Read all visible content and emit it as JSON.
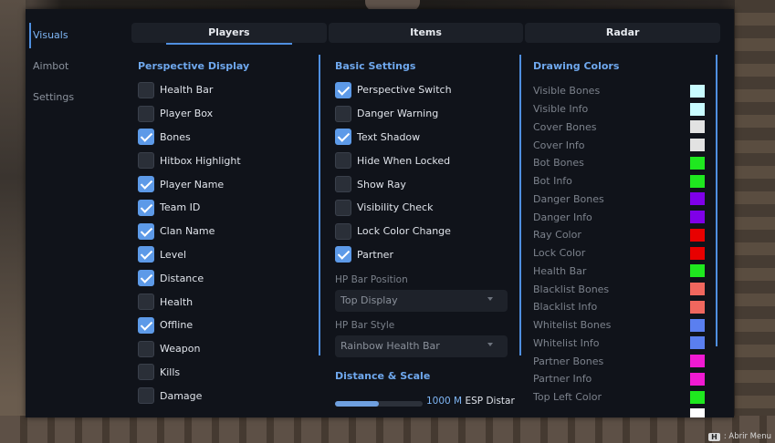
{
  "nav": {
    "items": [
      {
        "label": "Visuals",
        "active": true
      },
      {
        "label": "Aimbot",
        "active": false
      },
      {
        "label": "Settings",
        "active": false
      }
    ]
  },
  "tabs": [
    {
      "label": "Players",
      "active": true
    },
    {
      "label": "Items",
      "active": false
    },
    {
      "label": "Radar",
      "active": false
    }
  ],
  "perspective": {
    "title": "Perspective Display",
    "options": [
      {
        "label": "Health Bar",
        "checked": false
      },
      {
        "label": "Player Box",
        "checked": false
      },
      {
        "label": "Bones",
        "checked": true
      },
      {
        "label": "Hitbox Highlight",
        "checked": false
      },
      {
        "label": "Player Name",
        "checked": true
      },
      {
        "label": "Team ID",
        "checked": true
      },
      {
        "label": "Clan Name",
        "checked": true
      },
      {
        "label": "Level",
        "checked": true
      },
      {
        "label": "Distance",
        "checked": true
      },
      {
        "label": "Health",
        "checked": false
      },
      {
        "label": "Offline",
        "checked": true
      },
      {
        "label": "Weapon",
        "checked": false
      },
      {
        "label": "Kills",
        "checked": false
      },
      {
        "label": "Damage",
        "checked": false
      }
    ]
  },
  "basic": {
    "title": "Basic Settings",
    "options": [
      {
        "label": "Perspective Switch",
        "checked": true
      },
      {
        "label": "Danger Warning",
        "checked": false
      },
      {
        "label": "Text Shadow",
        "checked": true
      },
      {
        "label": "Hide When Locked",
        "checked": false
      },
      {
        "label": "Show Ray",
        "checked": false
      },
      {
        "label": "Visibility Check",
        "checked": false
      },
      {
        "label": "Lock Color Change",
        "checked": false
      },
      {
        "label": "Partner",
        "checked": true
      }
    ],
    "hp_bar_position_label": "HP Bar Position",
    "hp_bar_position_value": "Top Display",
    "hp_bar_style_label": "HP Bar Style",
    "hp_bar_style_value": "Rainbow Health Bar",
    "distance_title": "Distance & Scale",
    "esp_distance_value": "1000 M",
    "esp_distance_label": "ESP Distar",
    "esp_distance_fraction": 0.5
  },
  "colors": {
    "title": "Drawing Colors",
    "items": [
      {
        "label": "Visible Bones",
        "color": "#c8fbff"
      },
      {
        "label": "Visible Info",
        "color": "#c8fbff"
      },
      {
        "label": "Cover Bones",
        "color": "#e2e2e2"
      },
      {
        "label": "Cover Info",
        "color": "#e2e2e2"
      },
      {
        "label": "Bot Bones",
        "color": "#1fe81f"
      },
      {
        "label": "Bot Info",
        "color": "#1fe81f"
      },
      {
        "label": "Danger Bones",
        "color": "#7f00e8"
      },
      {
        "label": "Danger Info",
        "color": "#7f00e8"
      },
      {
        "label": "Ray Color",
        "color": "#e80000"
      },
      {
        "label": "Lock Color",
        "color": "#e80000"
      },
      {
        "label": "Health Bar",
        "color": "#1fe81f"
      },
      {
        "label": "Blacklist Bones",
        "color": "#f0675e"
      },
      {
        "label": "Blacklist Info",
        "color": "#f0675e"
      },
      {
        "label": "Whitelist Bones",
        "color": "#5a7ff0"
      },
      {
        "label": "Whitelist Info",
        "color": "#5a7ff0"
      },
      {
        "label": "Partner Bones",
        "color": "#f01ad2"
      },
      {
        "label": "Partner Info",
        "color": "#f01ad2"
      },
      {
        "label": "Top Left Color",
        "color": "#1fe81f"
      },
      {
        "label": "",
        "color": "#ffffff"
      }
    ]
  },
  "hint": {
    "key": "H",
    "label": ": Abrir Menu"
  },
  "accent": "#4f8fe0"
}
